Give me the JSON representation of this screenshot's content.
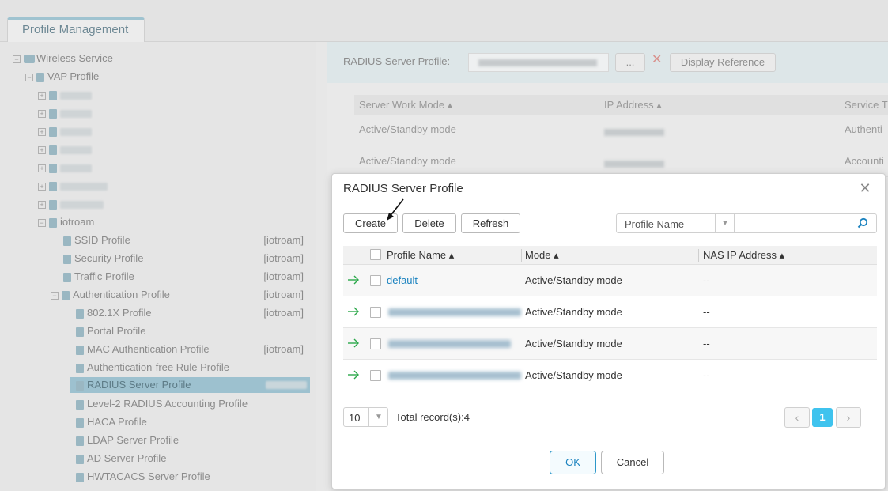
{
  "tabs": [
    {
      "label": "Profile Management"
    }
  ],
  "tree": {
    "root": "Wireless Service",
    "vap": "VAP Profile",
    "iotroam": "iotroam",
    "items": [
      {
        "label": "SSID Profile",
        "tag": "[iotroam]"
      },
      {
        "label": "Security Profile",
        "tag": "[iotroam]"
      },
      {
        "label": "Traffic Profile",
        "tag": "[iotroam]"
      },
      {
        "label": "Authentication Profile",
        "tag": "[iotroam]"
      },
      {
        "label": "802.1X Profile",
        "tag": "[iotroam]"
      },
      {
        "label": "Portal Profile",
        "tag": ""
      },
      {
        "label": "MAC Authentication Profile",
        "tag": "[iotroam]"
      },
      {
        "label": "Authentication-free Rule Profile",
        "tag": ""
      },
      {
        "label": "RADIUS Server Profile",
        "tag": ""
      },
      {
        "label": "Level-2 RADIUS Accounting Profile",
        "tag": ""
      },
      {
        "label": "HACA Profile",
        "tag": ""
      },
      {
        "label": "LDAP Server Profile",
        "tag": ""
      },
      {
        "label": "AD Server Profile",
        "tag": ""
      },
      {
        "label": "HWTACACS Server Profile",
        "tag": ""
      }
    ]
  },
  "panel": {
    "label": "RADIUS Server Profile:",
    "browse": "...",
    "display_reference": "Display Reference",
    "columns": [
      "Server Work Mode",
      "IP Address",
      "Service T"
    ],
    "rows": [
      {
        "mode": "Active/Standby mode",
        "service": "Authenti"
      },
      {
        "mode": "Active/Standby mode",
        "service": "Accounti"
      }
    ]
  },
  "modal": {
    "title": "RADIUS Server Profile",
    "toolbar": {
      "create": "Create",
      "delete": "Delete",
      "refresh": "Refresh"
    },
    "search": {
      "field": "Profile Name",
      "value": ""
    },
    "columns": {
      "name": "Profile Name",
      "mode": "Mode",
      "nas": "NAS IP Address"
    },
    "rows": [
      {
        "name": "default",
        "mode": "Active/Standby mode",
        "nas": "--"
      },
      {
        "name": "",
        "mode": "Active/Standby mode",
        "nas": "--"
      },
      {
        "name": "",
        "mode": "Active/Standby mode",
        "nas": "--"
      },
      {
        "name": "",
        "mode": "Active/Standby mode",
        "nas": "--"
      }
    ],
    "page_size": "10",
    "total": "Total record(s):4",
    "pager": {
      "prev": "‹",
      "current": "1",
      "next": "›"
    },
    "ok": "OK",
    "cancel": "Cancel"
  },
  "colors": {
    "accent": "#1a82bf",
    "page_current": "#3fc3ee",
    "arrow": "#2ba84a"
  }
}
